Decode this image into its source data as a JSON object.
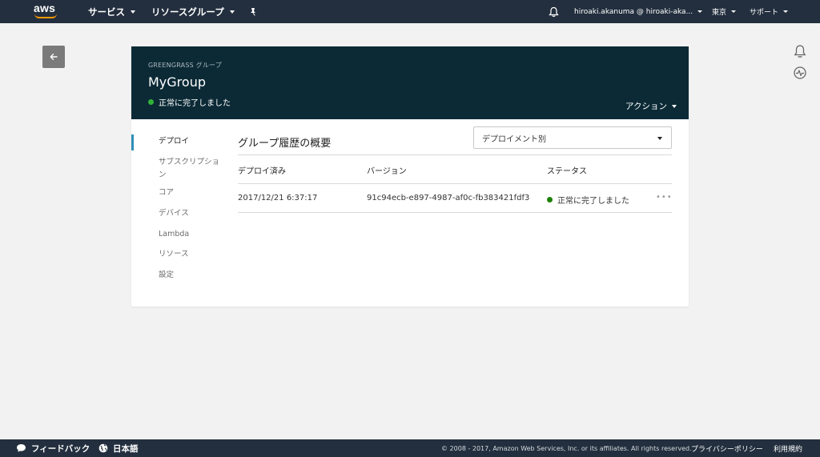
{
  "topnav": {
    "logo_text": "aws",
    "services": "サービス",
    "resource_groups": "リソースグループ",
    "pin_icon": "pushpin-icon",
    "bell_icon": "bell-icon",
    "account": "hiroaki.akanuma @ hiroaki-aka...",
    "region": "東京",
    "support": "サポート"
  },
  "header": {
    "kicker": "GREENGRASS グループ",
    "title": "MyGroup",
    "status": "正常に完了しました",
    "action": "アクション"
  },
  "menu": {
    "items": [
      {
        "label": "デプロイ"
      },
      {
        "label": "サブスクリプション"
      },
      {
        "label": "コア"
      },
      {
        "label": "デバイス"
      },
      {
        "label": "Lambda"
      },
      {
        "label": "リソース"
      },
      {
        "label": "設定"
      }
    ]
  },
  "main": {
    "section_title": "グループ履歴の概要",
    "select_value": "デプロイメント別",
    "columns": [
      "デプロイ済み",
      "バージョン",
      "ステータス"
    ],
    "rows": [
      {
        "deployed": "2017/12/21 6:37:17",
        "version": "91c94ecb-e897-4987-af0c-fb383421fdf3",
        "status": "正常に完了しました",
        "more": "•••"
      }
    ]
  },
  "footer": {
    "feedback": "フィードバック",
    "language": "日本語",
    "copyright": "© 2008 - 2017, Amazon Web Services, Inc. or its affiliates. All rights reserved.",
    "privacy": "プライバシーポリシー",
    "terms": "利用規約"
  },
  "colors": {
    "nav_bg": "#232f3e",
    "header_bg": "#0b2a36",
    "success": "#1d8102",
    "accent": "#ff9900",
    "active_indicator": "#2e8fb6"
  }
}
